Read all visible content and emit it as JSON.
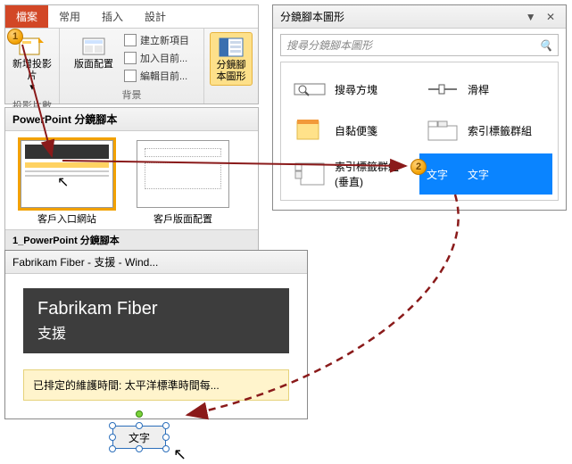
{
  "ribbon": {
    "tabs": [
      "檔案",
      "常用",
      "插入",
      "設計"
    ],
    "active_tab": 0,
    "groups": {
      "slides": {
        "new_slide": "新增投影片",
        "dropdown_indicator": "▾",
        "label": "投影片數"
      },
      "layout": {
        "button": "版面配置",
        "items": [
          "建立新項目",
          "加入目前...",
          "編輯目前..."
        ],
        "label": "背景"
      },
      "storyboard": {
        "button": "分鏡腳本圖形"
      }
    }
  },
  "slides_panel": {
    "title": "PowerPoint 分鏡腳本",
    "slides": [
      {
        "label": "客戶入口網站",
        "selected": true
      },
      {
        "label": "客戶版面配置",
        "selected": false
      }
    ],
    "footer": "1_PowerPoint 分鏡腳本"
  },
  "shapes_panel": {
    "title": "分鏡腳本圖形",
    "search_placeholder": "搜尋分鏡腳本圖形",
    "items": [
      {
        "label": "搜尋方塊"
      },
      {
        "label": "滑桿"
      },
      {
        "label": "自黏便箋"
      },
      {
        "label": "索引標籤群組"
      },
      {
        "label": "索引標籤群組 (垂直)"
      },
      {
        "label_a": "文字",
        "label_b": "文字",
        "selected": true
      }
    ]
  },
  "preview": {
    "window_title": "Fabrikam Fiber - 支援 - Wind...",
    "hero_title": "Fabrikam Fiber",
    "hero_subtitle": "支援",
    "banner_label": "已排定的維護時間:",
    "banner_text": "太平洋標準時間每...",
    "shape_text": "文字"
  },
  "callouts": {
    "1": "1",
    "2": "2"
  }
}
